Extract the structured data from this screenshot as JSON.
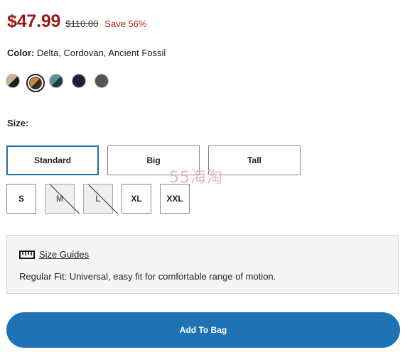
{
  "price": {
    "current": "$47.99",
    "original": "$110.00",
    "save": "Save 56%"
  },
  "color": {
    "label": "Color:",
    "value": "Delta, Cordovan, Ancient Fossil",
    "swatches": [
      {
        "name": "Delta",
        "colors": [
          "#c9b38f",
          "#1e1e1e"
        ]
      },
      {
        "name": "Cordovan",
        "colors": [
          "#c58a4f",
          "#3a2a20"
        ],
        "selected": true
      },
      {
        "name": "Ancient Fossil",
        "colors": [
          "#5f8e96",
          "#1e3d48"
        ]
      },
      {
        "name": "Navy",
        "colors": [
          "#1a2238",
          "#1a2238"
        ]
      },
      {
        "name": "Charcoal",
        "colors": [
          "#555555",
          "#555555"
        ]
      }
    ]
  },
  "size": {
    "label": "Size:",
    "fits": [
      {
        "label": "Standard",
        "selected": true
      },
      {
        "label": "Big"
      },
      {
        "label": "Tall"
      }
    ],
    "sizes": [
      {
        "label": "S",
        "available": true
      },
      {
        "label": "M",
        "available": false
      },
      {
        "label": "L",
        "available": false
      },
      {
        "label": "XL",
        "available": true
      },
      {
        "label": "XXL",
        "available": true
      }
    ]
  },
  "info": {
    "size_guides_label": "Size Guides",
    "fit_description": "Regular Fit: Universal, easy fit for comfortable range of motion.",
    "icon": "ruler-icon"
  },
  "cart": {
    "add_label": "Add To Bag"
  },
  "watermark": "55海淘",
  "colors": {
    "price": "#9b1a1a",
    "accent": "#1f72b3",
    "selected_border": "#1f6fa8"
  }
}
